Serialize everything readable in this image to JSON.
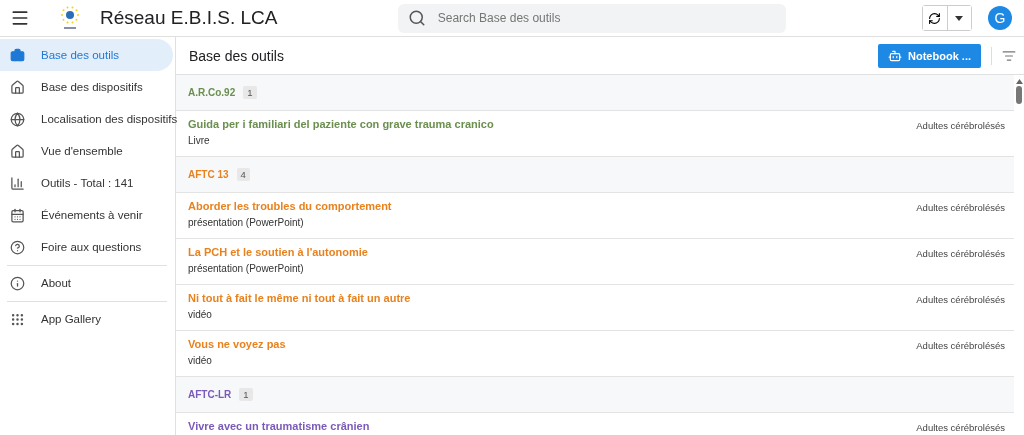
{
  "app_bar": {
    "title": "Réseau E.B.I.S. LCA",
    "search": {
      "placeholder": "Search Base des outils"
    },
    "avatar": "G"
  },
  "sidebar": {
    "sections": [
      [
        {
          "label": "Base des outils",
          "selected": true
        },
        {
          "label": "Base des dispositifs",
          "selected": false
        },
        {
          "label": "Localisation des dispositifs",
          "selected": false
        },
        {
          "label": "Vue d'ensemble",
          "selected": false
        },
        {
          "label": "Outils - Total : 141",
          "selected": false
        },
        {
          "label": "Événements à venir",
          "selected": false
        },
        {
          "label": "Foire aux questions",
          "selected": false
        }
      ],
      [
        {
          "label": "About",
          "selected": false
        }
      ],
      [
        {
          "label": "App Gallery",
          "selected": false
        }
      ]
    ]
  },
  "content": {
    "title": "Base des outils",
    "action_button": "Notebook ...",
    "groups": [
      {
        "name": "A.R.Co.92",
        "count": "1",
        "color": "#6a8f4f",
        "items": [
          {
            "title": "Guida per i familiari del paziente con grave trauma cranico",
            "type": "Livre",
            "category": "Adultes cérébrolésés"
          }
        ]
      },
      {
        "name": "AFTC 13",
        "count": "4",
        "color": "#e8821e",
        "items": [
          {
            "title": "Aborder les troubles du comportement",
            "type": "présentation (PowerPoint)",
            "category": "Adultes cérébrolésés"
          },
          {
            "title": "La PCH et le soutien à l'autonomie",
            "type": "présentation (PowerPoint)",
            "category": "Adultes cérébrolésés"
          },
          {
            "title": "Ni tout à fait le même ni tout à fait un autre",
            "type": "vidéo",
            "category": "Adultes cérébrolésés"
          },
          {
            "title": "Vous ne voyez pas",
            "type": "vidéo",
            "category": "Adultes cérébrolésés"
          }
        ]
      },
      {
        "name": "AFTC-LR",
        "count": "1",
        "color": "#7b5ab8",
        "items": [
          {
            "title": "Vivre avec un traumatisme crânien",
            "category": "Adultes cérébrolésés"
          }
        ]
      }
    ]
  }
}
